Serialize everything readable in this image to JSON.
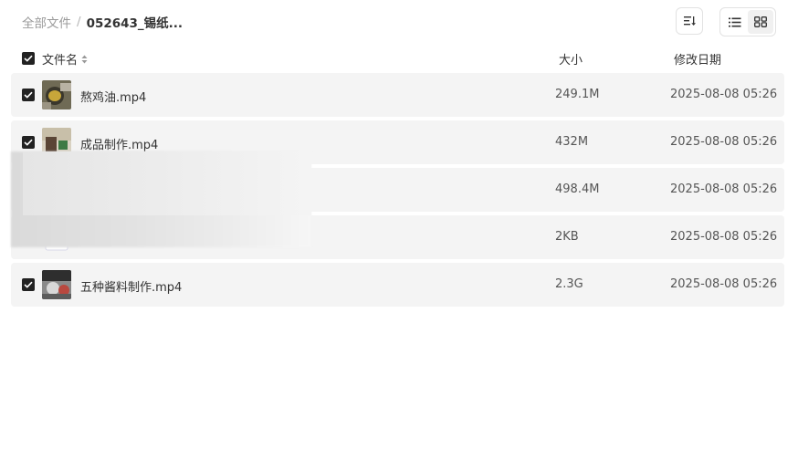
{
  "breadcrumb": {
    "root": "全部文件",
    "separator": "/",
    "current": "052643_锡纸..."
  },
  "toolbar": {
    "sort_icon": "sort-icon",
    "list_view_icon": "list-view-icon",
    "grid_view_icon": "grid-view-icon"
  },
  "header": {
    "name": "文件名",
    "size": "大小",
    "date": "修改日期"
  },
  "files": [
    {
      "name": "熬鸡油.mp4",
      "size": "249.1M",
      "date": "2025-08-08 05:26",
      "checked": true,
      "thumb": "video-thumbnail"
    },
    {
      "name": "成品制作.mp4",
      "size": "432M",
      "date": "2025-08-08 05:26",
      "checked": true,
      "thumb": "video-thumbnail"
    },
    {
      "name": "",
      "size": "498.4M",
      "date": "2025-08-08 05:26",
      "checked": true,
      "thumb": "video-thumbnail"
    },
    {
      "name": "",
      "size": "2KB",
      "date": "2025-08-08 05:26",
      "checked": true,
      "thumb": "document-icon"
    },
    {
      "name": "五种酱料制作.mp4",
      "size": "2.3G",
      "date": "2025-08-08 05:26",
      "checked": true,
      "thumb": "video-thumbnail"
    }
  ],
  "colors": {
    "row_bg": "#f4f4f4",
    "checkbox": "#222222",
    "muted_text": "#9a9a9a"
  }
}
